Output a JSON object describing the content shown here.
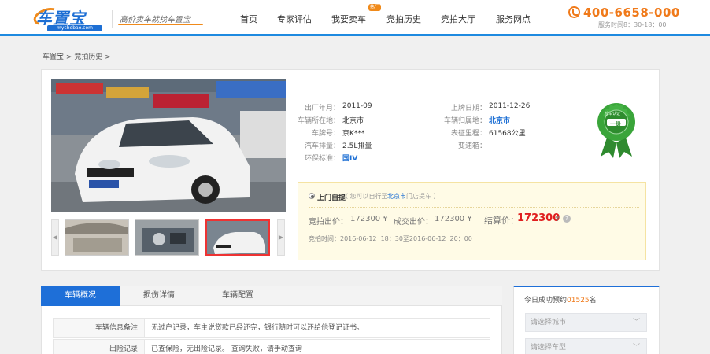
{
  "header": {
    "logo_text": "车置宝",
    "logo_domain": "mychebao.com",
    "slogan": "高价卖车就找车置宝",
    "nav": [
      "首页",
      "专家评估",
      "我要卖车",
      "竞拍历史",
      "竞拍大厅",
      "服务网点"
    ],
    "nav_badge": "热门",
    "phone": "400-6658-000",
    "hours": "服务时间8：30-18：00"
  },
  "breadcrumb": {
    "items": [
      "车置宝",
      "竞拍历史"
    ],
    "sep": ">"
  },
  "specs": {
    "labels_left": [
      "出厂年月：",
      "车辆所在地：",
      "车牌号：",
      "汽车排量：",
      "环保标准："
    ],
    "values_left": [
      "2011-09",
      "北京市",
      "京K***",
      "2.5L排量",
      "国IV"
    ],
    "labels_right": [
      "上牌日期：",
      "车辆归属地：",
      "表征里程：",
      "变速箱："
    ],
    "values_right": [
      "2011-12-26",
      "北京市",
      "61568公里",
      ""
    ]
  },
  "medal": {
    "ring_text": "检车认证",
    "grade": "一级"
  },
  "offer": {
    "pickup_label": "上门自提",
    "pickup_note_pre": "（ 您可以自行至",
    "pickup_city": "北京市",
    "pickup_note_post": "门店提车 ）",
    "bid_label": "竞拍出价：",
    "bid_value": "172300 ¥",
    "deal_label": "成交出价：",
    "deal_value": "172300 ¥",
    "settle_label": "结算价：",
    "settle_value": "172300",
    "settle_unit": "¥",
    "time_label": "竞拍时间：",
    "time_value": "2016-06-12  18：30至2016-06-12  20：00"
  },
  "tabs": [
    "车辆概况",
    "损伤详情",
    "车辆配置"
  ],
  "table": {
    "rows": [
      {
        "label": "车辆信息备注",
        "value": "无过户记录，车主说贷款已经还完，银行随时可以还给他登记证书。"
      },
      {
        "label": "出险记录",
        "value": "已查保险，无出险记录。 查询失败，请手动查询"
      }
    ]
  },
  "sidebar": {
    "title_pre": "今日成功预约",
    "count": "01525",
    "title_post": "名",
    "select_city": "请选择城市",
    "select_model": "请选择车型"
  },
  "colors": {
    "brand_blue": "#1d6fd4",
    "accent_orange": "#f07a1a",
    "settle_red": "#e01e1e",
    "medal_green": "#3a9a3a"
  }
}
